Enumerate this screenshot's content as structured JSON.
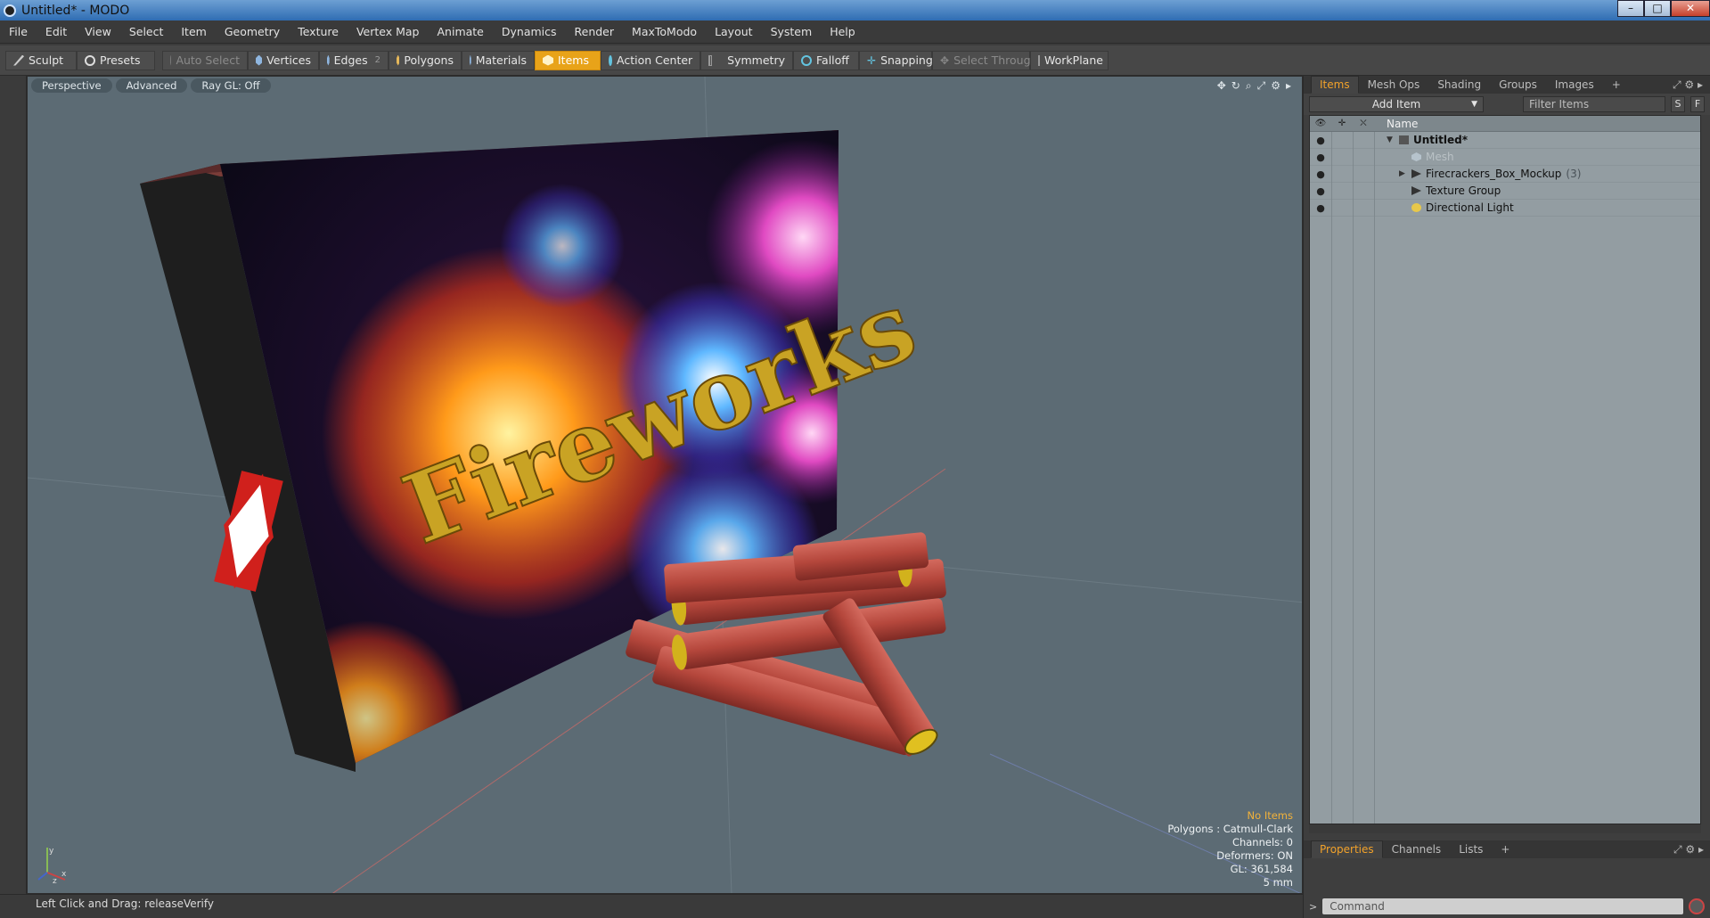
{
  "window": {
    "title": "Untitled* - MODO",
    "buttons": {
      "minimize": "–",
      "maximize": "□",
      "close": "✕"
    }
  },
  "menu": [
    "File",
    "Edit",
    "View",
    "Select",
    "Item",
    "Geometry",
    "Texture",
    "Vertex Map",
    "Animate",
    "Dynamics",
    "Render",
    "MaxToModo",
    "Layout",
    "System",
    "Help"
  ],
  "toolbar": {
    "sculpt": "Sculpt",
    "presets": "Presets",
    "auto_select": "Auto Select",
    "vertices": "Vertices",
    "edges": "Edges",
    "edges_count": "2",
    "polygons": "Polygons",
    "materials": "Materials",
    "items": "Items",
    "action_center": "Action Center",
    "symmetry": "Symmetry",
    "falloff": "Falloff",
    "snapping": "Snapping",
    "select_through": "Select Through",
    "workplane": "WorkPlane"
  },
  "viewport": {
    "tabs": [
      "Perspective",
      "Advanced",
      "Ray GL: Off"
    ],
    "scene_text": "Fireworks",
    "hud": {
      "status": "No Items",
      "polygons": "Polygons : Catmull-Clark",
      "channels": "Channels: 0",
      "deformers": "Deformers: ON",
      "gl": "GL: 361,584",
      "scale": "5 mm"
    },
    "axes": {
      "y": "y",
      "x": "x",
      "z": "z"
    },
    "colors": {
      "background": "#5c6b74",
      "box": "#1e1e1e",
      "text": "#c9a324",
      "firecracker": "#b5473c"
    }
  },
  "status_bar": "Left Click and Drag:  releaseVerify",
  "right_panel": {
    "tabs": [
      "Items",
      "Mesh Ops",
      "Shading",
      "Groups",
      "Images",
      "+"
    ],
    "add_item": "Add Item",
    "filter_placeholder": "Filter Items",
    "s_button": "S",
    "f_button": "F",
    "header_name": "Name",
    "tree": [
      {
        "label": "Untitled*",
        "icon": "scene-icon",
        "expanded": true
      },
      {
        "label": "Mesh",
        "icon": "mesh-icon",
        "dimmed": true
      },
      {
        "label": "Firecrackers_Box_Mockup",
        "count": "(3)",
        "icon": "locator-icon",
        "expandable": true
      },
      {
        "label": "Texture Group",
        "icon": "texture-group-icon"
      },
      {
        "label": "Directional Light",
        "icon": "light-icon"
      }
    ],
    "bottom_tabs": [
      "Properties",
      "Channels",
      "Lists",
      "+"
    ],
    "command_prompt": ">",
    "command_placeholder": "Command"
  }
}
